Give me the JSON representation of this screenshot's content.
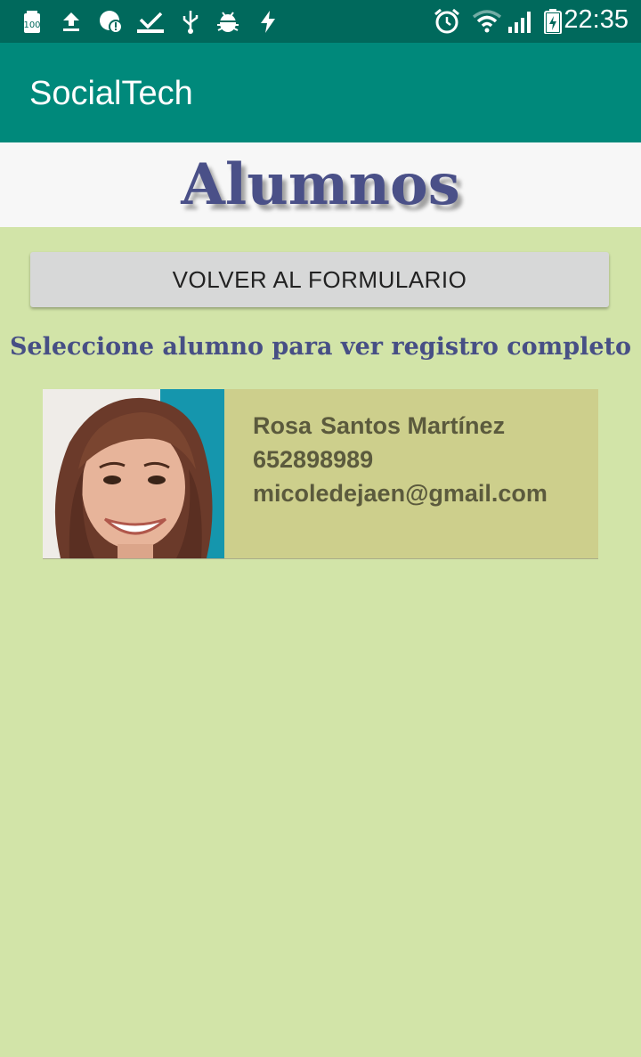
{
  "status_bar": {
    "time": "22:35",
    "left_icons": [
      "battery-100-icon",
      "upload-icon",
      "app-alert-icon",
      "download-done-icon",
      "usb-icon",
      "android-debug-icon",
      "flash-icon"
    ],
    "right_icons": [
      "alarm-icon",
      "wifi-icon",
      "signal-icon",
      "battery-charging-icon"
    ],
    "battery_badge": "100"
  },
  "app_bar": {
    "title": "SocialTech"
  },
  "banner": {
    "title": "Alumnos"
  },
  "back_button": {
    "label": "VOLVER AL FORMULARIO"
  },
  "instructions": "Seleccione alumno para ver registro completo",
  "students": [
    {
      "first_name": "Rosa",
      "last_name": "Santos Martínez",
      "phone": "652898989",
      "email": "micoledejaen@gmail.com"
    }
  ],
  "colors": {
    "status_bar": "#00695c",
    "app_bar": "#00897b",
    "background": "#d2e4a8",
    "card": "#cdcf8c",
    "title_text": "#4a5088"
  }
}
